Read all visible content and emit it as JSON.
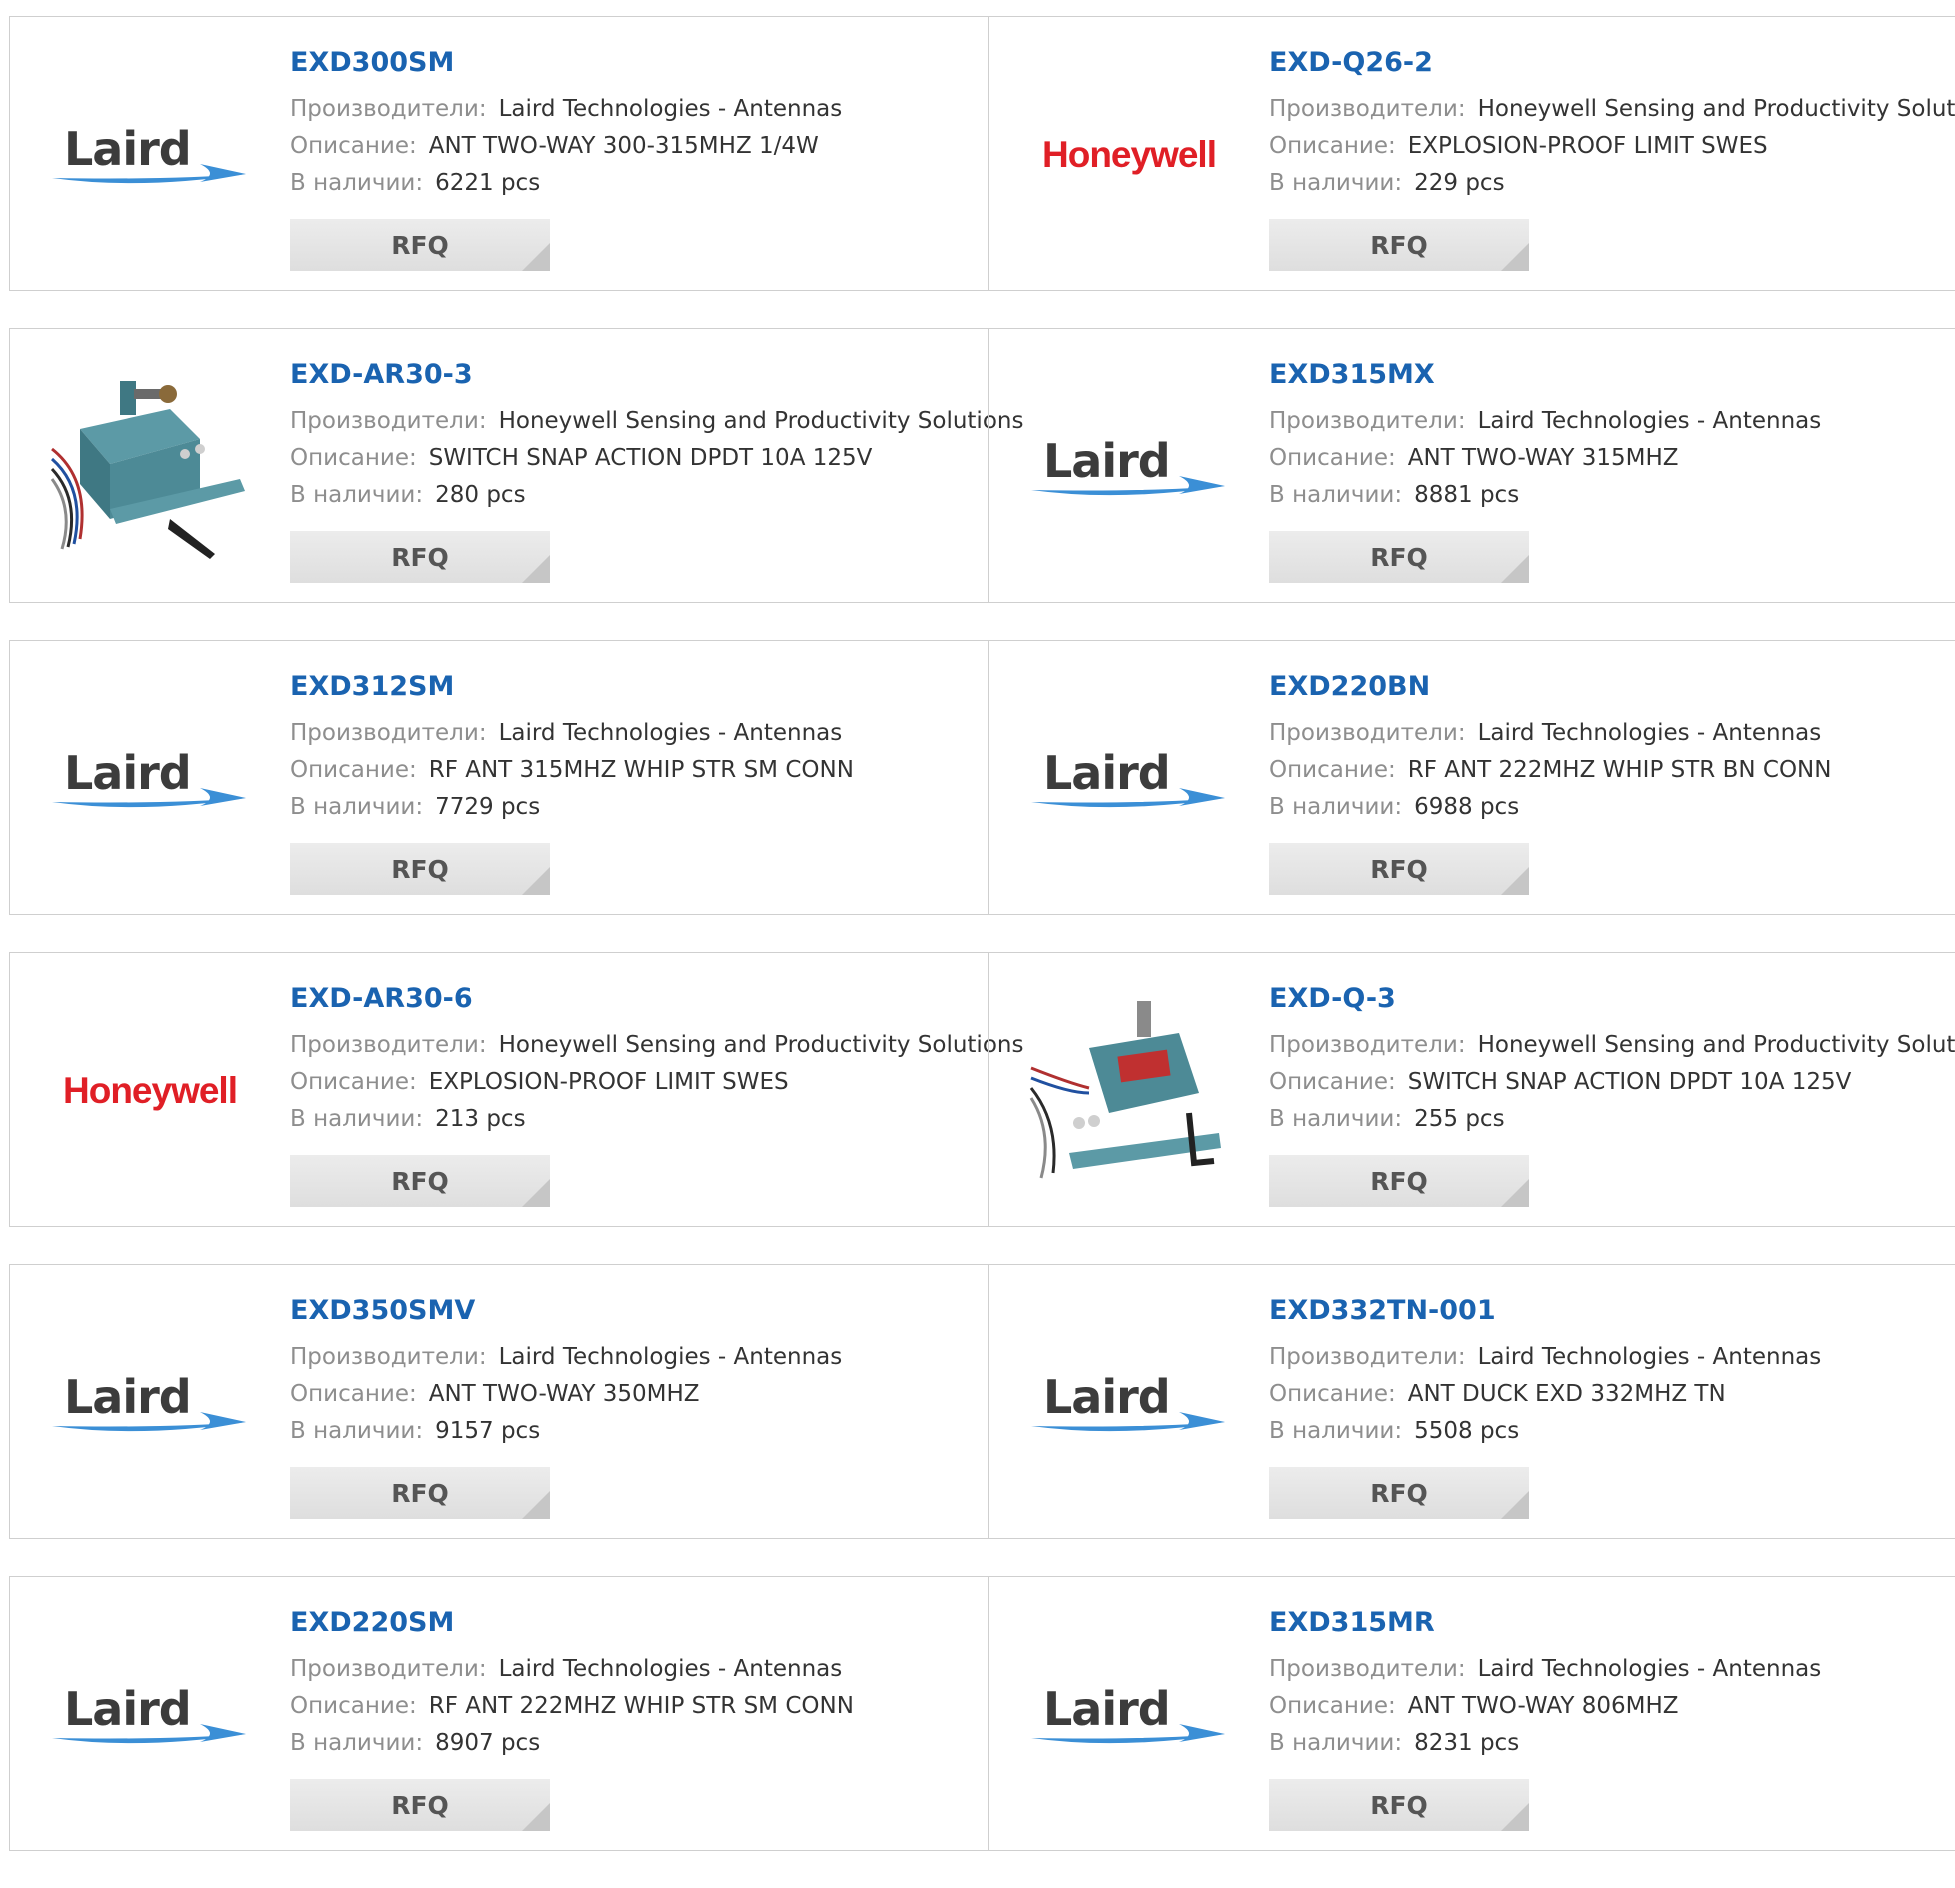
{
  "labels": {
    "manufacturer": "Производители:",
    "description": "Описание:",
    "stock": "В наличии:",
    "rfq": "RFQ"
  },
  "colors": {
    "link": "#1a63b0",
    "label": "#8e8e8e",
    "value": "#333333",
    "honeywell_red": "#e01f26",
    "laird_blue": "#3b8fd6"
  },
  "products": [
    {
      "part": "EXD300SM",
      "manufacturer": "Laird Technologies - Antennas",
      "description": "ANT TWO-WAY 300-315MHZ 1/4W",
      "stock": "6221 pcs",
      "logo": "laird",
      "logo_text": "Laird"
    },
    {
      "part": "EXD-Q26-2",
      "manufacturer": "Honeywell Sensing and Productivity Solutions",
      "description": "EXPLOSION-PROOF LIMIT SWES",
      "stock": "229 pcs",
      "logo": "honeywell",
      "logo_text": "Honeywell"
    },
    {
      "part": "EXD-AR30-3",
      "manufacturer": "Honeywell Sensing and Productivity Solutions",
      "description": "SWITCH SNAP ACTION DPDT 10A 125V",
      "stock": "280 pcs",
      "logo": "switch-photo-a",
      "logo_text": ""
    },
    {
      "part": "EXD315MX",
      "manufacturer": "Laird Technologies - Antennas",
      "description": "ANT TWO-WAY 315MHZ",
      "stock": "8881 pcs",
      "logo": "laird",
      "logo_text": "Laird"
    },
    {
      "part": "EXD312SM",
      "manufacturer": "Laird Technologies - Antennas",
      "description": "RF ANT 315MHZ WHIP STR SM CONN",
      "stock": "7729 pcs",
      "logo": "laird",
      "logo_text": "Laird"
    },
    {
      "part": "EXD220BN",
      "manufacturer": "Laird Technologies - Antennas",
      "description": "RF ANT 222MHZ WHIP STR BN CONN",
      "stock": "6988 pcs",
      "logo": "laird",
      "logo_text": "Laird"
    },
    {
      "part": "EXD-AR30-6",
      "manufacturer": "Honeywell Sensing and Productivity Solutions",
      "description": "EXPLOSION-PROOF LIMIT SWES",
      "stock": "213 pcs",
      "logo": "honeywell",
      "logo_text": "Honeywell"
    },
    {
      "part": "EXD-Q-3",
      "manufacturer": "Honeywell Sensing and Productivity Solutions",
      "description": "SWITCH SNAP ACTION DPDT 10A 125V",
      "stock": "255 pcs",
      "logo": "switch-photo-b",
      "logo_text": ""
    },
    {
      "part": "EXD350SMV",
      "manufacturer": "Laird Technologies - Antennas",
      "description": "ANT TWO-WAY 350MHZ",
      "stock": "9157 pcs",
      "logo": "laird",
      "logo_text": "Laird"
    },
    {
      "part": "EXD332TN-001",
      "manufacturer": "Laird Technologies - Antennas",
      "description": "ANT DUCK EXD 332MHZ TN",
      "stock": "5508 pcs",
      "logo": "laird",
      "logo_text": "Laird"
    },
    {
      "part": "EXD220SM",
      "manufacturer": "Laird Technologies - Antennas",
      "description": "RF ANT 222MHZ WHIP STR SM CONN",
      "stock": "8907 pcs",
      "logo": "laird",
      "logo_text": "Laird"
    },
    {
      "part": "EXD315MR",
      "manufacturer": "Laird Technologies - Antennas",
      "description": "ANT TWO-WAY 806MHZ",
      "stock": "8231 pcs",
      "logo": "laird",
      "logo_text": "Laird"
    }
  ]
}
